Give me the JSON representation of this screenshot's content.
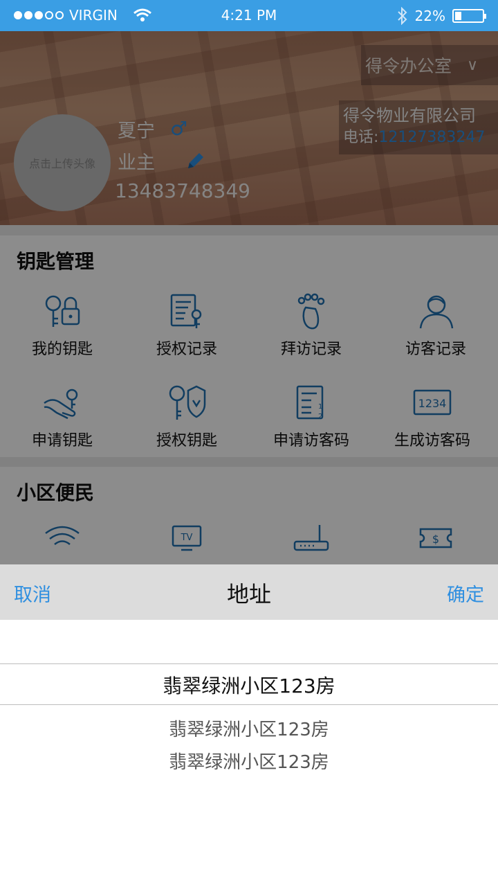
{
  "status_bar": {
    "carrier": "VIRGIN",
    "time": "4:21 PM",
    "battery": "22%"
  },
  "header": {
    "office": "得令办公室",
    "company_name": "得令物业有限公司",
    "company_phone_label": "电话:",
    "company_phone": "12127383247",
    "avatar_text": "点击上传头像",
    "user_name": "夏宁",
    "gender_symbol": "♂",
    "role": "业主",
    "user_phone": "13483748349"
  },
  "key_section": {
    "title": "钥匙管理",
    "items": [
      {
        "label": "我的钥匙",
        "icon": "key-lock-icon"
      },
      {
        "label": "授权记录",
        "icon": "document-key-icon"
      },
      {
        "label": "拜访记录",
        "icon": "footprint-icon"
      },
      {
        "label": "访客记录",
        "icon": "user-icon"
      },
      {
        "label": "申请钥匙",
        "icon": "hand-key-icon"
      },
      {
        "label": "授权钥匙",
        "icon": "key-shield-icon"
      },
      {
        "label": "申请访客码",
        "icon": "list-numbers-icon"
      },
      {
        "label": "生成访客码",
        "icon": "code-1234-icon"
      }
    ],
    "code_text": "1234",
    "list_numbers": [
      "1",
      "2"
    ]
  },
  "community_section": {
    "title": "小区便民",
    "items": [
      {
        "icon": "wifi-icon"
      },
      {
        "icon": "tv-icon",
        "icon_text": "TV"
      },
      {
        "icon": "router-icon"
      },
      {
        "icon": "coupon-icon",
        "icon_text": "$"
      }
    ]
  },
  "picker": {
    "cancel_label": "取消",
    "title": "地址",
    "confirm_label": "确定",
    "selected": "翡翠绿洲小区123房",
    "options": [
      "翡翠绿洲小区123房",
      "翡翠绿洲小区123房"
    ]
  },
  "colors": {
    "accent": "#2f8fe0",
    "status_bar": "#3a9ee4",
    "icon_blue": "#1f6fb0"
  }
}
